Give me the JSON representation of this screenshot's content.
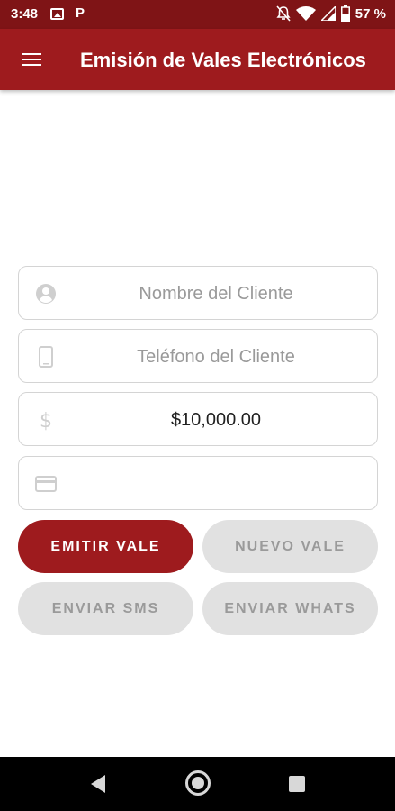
{
  "status_bar": {
    "time": "3:48",
    "battery": "57 %",
    "icons": [
      "image-icon",
      "p-icon",
      "notifications-off-icon",
      "wifi-icon",
      "signal-icon",
      "battery-icon"
    ]
  },
  "app_bar": {
    "title": "Emisión de Vales Electrónicos",
    "background": "#9e1b1e"
  },
  "form": {
    "client_name": {
      "value": "",
      "placeholder": "Nombre del Cliente",
      "icon": "person-icon"
    },
    "client_phone": {
      "value": "",
      "placeholder": "Teléfono del Cliente",
      "icon": "phone-icon"
    },
    "amount": {
      "value": "$10,000.00",
      "icon": "dollar-icon"
    },
    "card": {
      "value": "",
      "icon": "credit-card-icon"
    }
  },
  "buttons": {
    "emit": "EMITIR VALE",
    "new": "NUEVO VALE",
    "send_sms": "ENVIAR SMS",
    "send_whats": "ENVIAR WHATS"
  },
  "colors": {
    "primary": "#9e1b1e",
    "status_bar": "#7f1416",
    "secondary_button": "#e1e1e1"
  }
}
